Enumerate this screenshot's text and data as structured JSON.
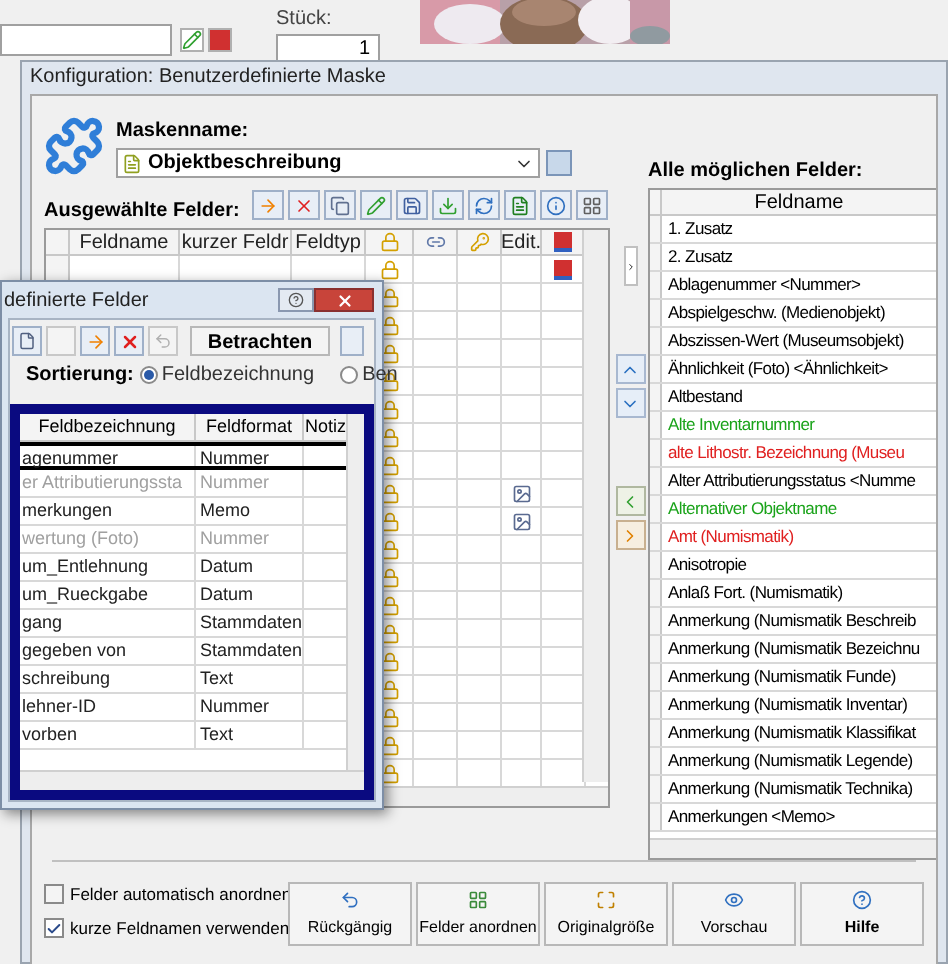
{
  "background_app": {
    "quantity_label": "Stück:",
    "quantity_value": "1"
  },
  "dialog": {
    "title": "Konfiguration: Benutzerdefinierte Maske",
    "mask_label": "Maskenname:",
    "mask_name": "Objektbeschreibung",
    "selected_label": "Ausgewählte Felder:",
    "selected_columns": [
      {
        "kind": "text",
        "label": "Feldname"
      },
      {
        "kind": "text",
        "label": "kurzer Feldr"
      },
      {
        "kind": "text",
        "label": "Feldtyp"
      },
      {
        "kind": "lock"
      },
      {
        "kind": "link"
      },
      {
        "kind": "key"
      },
      {
        "kind": "text",
        "label": "Edit."
      },
      {
        "kind": "mark"
      }
    ],
    "selected_rows": [
      {
        "locked": true,
        "image": false,
        "marked": true
      },
      {
        "locked": true,
        "image": false,
        "marked": false
      },
      {
        "locked": true,
        "image": false,
        "marked": false
      },
      {
        "locked": true,
        "image": false,
        "marked": false
      },
      {
        "locked": true,
        "image": false,
        "marked": false
      },
      {
        "locked": true,
        "image": false,
        "marked": false
      },
      {
        "locked": true,
        "image": false,
        "marked": false
      },
      {
        "locked": true,
        "image": false,
        "marked": false
      },
      {
        "locked": true,
        "image": true,
        "marked": false
      },
      {
        "locked": true,
        "image": true,
        "marked": false
      },
      {
        "locked": true,
        "image": false,
        "marked": false
      },
      {
        "locked": true,
        "image": false,
        "marked": false
      },
      {
        "locked": true,
        "image": false,
        "marked": false
      },
      {
        "locked": true,
        "image": false,
        "marked": false
      },
      {
        "locked": true,
        "image": false,
        "marked": false
      },
      {
        "locked": true,
        "image": false,
        "marked": false
      },
      {
        "locked": true,
        "image": false,
        "marked": false
      },
      {
        "locked": true,
        "image": false,
        "marked": false
      },
      {
        "locked": true,
        "image": false,
        "marked": false
      }
    ],
    "all_label": "Alle möglichen Felder:",
    "all_column": "Feldname",
    "all_rows": [
      {
        "name": "1. Zusatz",
        "color": "#000000"
      },
      {
        "name": "2. Zusatz",
        "color": "#000000"
      },
      {
        "name": "Ablagenummer <Nummer>",
        "color": "#000000"
      },
      {
        "name": "Abspielgeschw. (Medienobjekt)",
        "color": "#000000"
      },
      {
        "name": "Abszissen-Wert (Museumsobjekt)",
        "color": "#000000"
      },
      {
        "name": "Ähnlichkeit (Foto) <Ähnlichkeit>",
        "color": "#000000"
      },
      {
        "name": "Altbestand",
        "color": "#000000"
      },
      {
        "name": "Alte Inventarnummer",
        "color": "#1aa31a"
      },
      {
        "name": "alte Lithostr. Bezeichnung (Museu",
        "color": "#e02020"
      },
      {
        "name": "Alter Attributierungsstatus <Numme",
        "color": "#000000"
      },
      {
        "name": "Alternativer Objektname",
        "color": "#1aa31a"
      },
      {
        "name": "Amt (Numismatik)",
        "color": "#e02020"
      },
      {
        "name": "Anisotropie",
        "color": "#000000"
      },
      {
        "name": "Anlaß Fort. (Numismatik)",
        "color": "#000000"
      },
      {
        "name": "Anmerkung (Numismatik Beschreib",
        "color": "#000000"
      },
      {
        "name": "Anmerkung (Numismatik Bezeichnu",
        "color": "#000000"
      },
      {
        "name": "Anmerkung (Numismatik Funde)",
        "color": "#000000"
      },
      {
        "name": "Anmerkung (Numismatik Inventar)",
        "color": "#000000"
      },
      {
        "name": "Anmerkung (Numismatik Klassifikat",
        "color": "#000000"
      },
      {
        "name": "Anmerkung (Numismatik Legende)",
        "color": "#000000"
      },
      {
        "name": "Anmerkung (Numismatik Technika)",
        "color": "#000000"
      },
      {
        "name": "Anmerkungen <Memo>",
        "color": "#000000"
      }
    ],
    "options": [
      {
        "label": "Felder automatisch anordnen",
        "checked": false
      },
      {
        "label": "kurze Feldnamen verwenden",
        "checked": true
      }
    ],
    "buttons": [
      {
        "kind": "undo",
        "label": "Rückgängig",
        "bold": false
      },
      {
        "kind": "arrange",
        "label": "Felder anordnen",
        "bold": false
      },
      {
        "kind": "fit",
        "label": "Originalgröße",
        "bold": false
      },
      {
        "kind": "preview",
        "label": "Vorschau",
        "bold": false
      },
      {
        "kind": "help",
        "label": "Hilfe",
        "bold": true
      }
    ]
  },
  "fields_window": {
    "title": "definierte Felder",
    "view_button": "Betrachten",
    "sort_label": "Sortierung:",
    "sort_options": [
      {
        "label": "Feldbezeichnung",
        "selected": true
      },
      {
        "label": "Ben",
        "selected": false
      }
    ],
    "columns": [
      "Feldbezeichnung",
      "Feldformat",
      "Notiz"
    ],
    "rows": [
      {
        "name": "agenummer",
        "format": "Nummer",
        "selected": true,
        "disabled": false
      },
      {
        "name": "er Attributierungssta",
        "format": "Nummer",
        "selected": false,
        "disabled": true
      },
      {
        "name": "merkungen",
        "format": "Memo",
        "selected": false,
        "disabled": false
      },
      {
        "name": "wertung (Foto)",
        "format": "Nummer",
        "selected": false,
        "disabled": true
      },
      {
        "name": "um_Entlehnung",
        "format": "Datum",
        "selected": false,
        "disabled": false
      },
      {
        "name": "um_Rueckgabe",
        "format": "Datum",
        "selected": false,
        "disabled": false
      },
      {
        "name": "gang",
        "format": "Stammdaten",
        "selected": false,
        "disabled": false
      },
      {
        "name": "gegeben von",
        "format": "Stammdaten",
        "selected": false,
        "disabled": false
      },
      {
        "name": "schreibung",
        "format": "Text",
        "selected": false,
        "disabled": false
      },
      {
        "name": "lehner-ID",
        "format": "Nummer",
        "selected": false,
        "disabled": false
      },
      {
        "name": "vorben",
        "format": "Text",
        "selected": false,
        "disabled": false
      }
    ]
  }
}
